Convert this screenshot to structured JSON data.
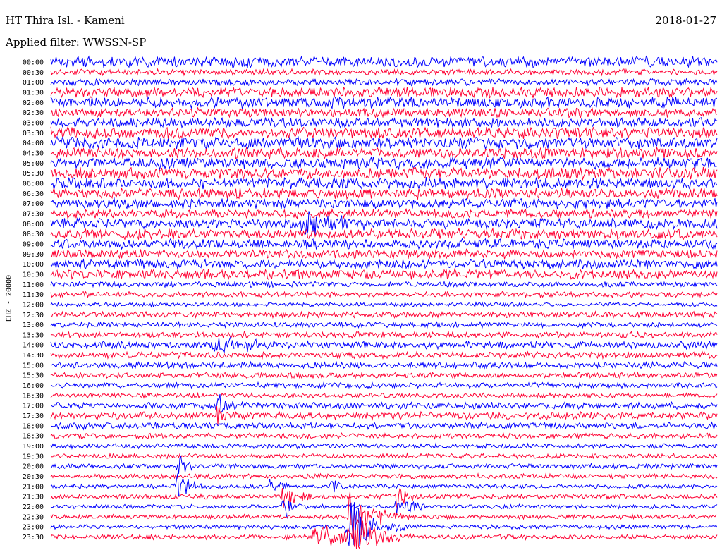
{
  "header": {
    "station": "HT Thira Isl. - Kameni",
    "date": "2018-01-27",
    "filter": "Applied filter: WWSSN-SP"
  },
  "chart_data": {
    "type": "line",
    "title": "HT Thira Isl. - Kameni",
    "ylabel": "EHZ - 20000",
    "y_tick_labels": [
      "00:00",
      "00:30",
      "01:00",
      "01:30",
      "02:00",
      "02:30",
      "03:00",
      "03:30",
      "04:00",
      "04:30",
      "05:00",
      "05:30",
      "06:00",
      "06:30",
      "07:00",
      "07:30",
      "08:00",
      "08:30",
      "09:00",
      "09:30",
      "10:00",
      "10:30",
      "11:00",
      "11:30",
      "12:00",
      "12:30",
      "13:00",
      "13:30",
      "14:00",
      "14:30",
      "15:00",
      "15:30",
      "16:00",
      "16:30",
      "17:00",
      "17:30",
      "18:00",
      "18:30",
      "19:00",
      "19:30",
      "20:00",
      "20:30",
      "21:00",
      "21:30",
      "22:00",
      "22:30",
      "23:00",
      "23:30"
    ],
    "trace_colors": [
      "#0000ff",
      "#ff0033"
    ],
    "background": "#ffffff",
    "rows": 48,
    "row_duration_minutes": 30,
    "noise_level": [
      0.9,
      0.5,
      0.55,
      0.85,
      0.9,
      0.75,
      0.8,
      0.95,
      1.0,
      0.9,
      0.95,
      0.95,
      0.95,
      0.85,
      0.85,
      0.75,
      0.85,
      0.9,
      0.8,
      0.75,
      0.75,
      0.8,
      0.45,
      0.45,
      0.35,
      0.5,
      0.45,
      0.5,
      0.6,
      0.55,
      0.55,
      0.45,
      0.45,
      0.4,
      0.55,
      0.6,
      0.55,
      0.45,
      0.4,
      0.4,
      0.4,
      0.4,
      0.35,
      0.4,
      0.35,
      0.35,
      0.35,
      0.4
    ],
    "events": [
      {
        "row": 16,
        "x_fraction": 0.38,
        "amplitude": 1.6,
        "duration_fraction": 0.04
      },
      {
        "row": 28,
        "x_fraction": 0.25,
        "amplitude": 1.5,
        "duration_fraction": 0.04
      },
      {
        "row": 34,
        "x_fraction": 0.25,
        "amplitude": 2.2,
        "duration_fraction": 0.01
      },
      {
        "row": 35,
        "x_fraction": 0.25,
        "amplitude": 2.0,
        "duration_fraction": 0.01
      },
      {
        "row": 40,
        "x_fraction": 0.19,
        "amplitude": 2.2,
        "duration_fraction": 0.01
      },
      {
        "row": 42,
        "x_fraction": 0.19,
        "amplitude": 2.8,
        "duration_fraction": 0.015
      },
      {
        "row": 42,
        "x_fraction": 0.33,
        "amplitude": 2.0,
        "duration_fraction": 0.01
      },
      {
        "row": 42,
        "x_fraction": 0.42,
        "amplitude": 1.8,
        "duration_fraction": 0.01
      },
      {
        "row": 43,
        "x_fraction": 0.35,
        "amplitude": 3.2,
        "duration_fraction": 0.015
      },
      {
        "row": 43,
        "x_fraction": 0.52,
        "amplitude": 3.6,
        "duration_fraction": 0.01
      },
      {
        "row": 44,
        "x_fraction": 0.35,
        "amplitude": 2.4,
        "duration_fraction": 0.015
      },
      {
        "row": 44,
        "x_fraction": 0.52,
        "amplitude": 2.6,
        "duration_fraction": 0.015
      },
      {
        "row": 45,
        "x_fraction": 0.45,
        "amplitude": 4.2,
        "duration_fraction": 0.03
      },
      {
        "row": 46,
        "x_fraction": 0.45,
        "amplitude": 4.5,
        "duration_fraction": 0.03
      },
      {
        "row": 47,
        "x_fraction": 0.4,
        "amplitude": 2.6,
        "duration_fraction": 0.04
      },
      {
        "row": 47,
        "x_fraction": 0.45,
        "amplitude": 4.0,
        "duration_fraction": 0.03
      }
    ]
  }
}
